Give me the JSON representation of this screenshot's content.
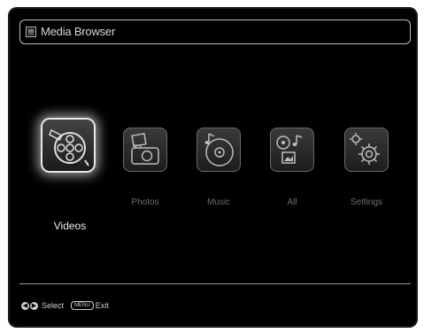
{
  "header": {
    "title": "Media Browser",
    "icon": "media-browser-icon"
  },
  "items": [
    {
      "label": "Videos",
      "icon": "film-reel-icon",
      "selected": true
    },
    {
      "label": "Photos",
      "icon": "photo-camera-icon",
      "selected": false
    },
    {
      "label": "Music",
      "icon": "music-disc-icon",
      "selected": false
    },
    {
      "label": "All",
      "icon": "all-media-icon",
      "selected": false
    },
    {
      "label": "Settings",
      "icon": "gear-icon",
      "selected": false
    }
  ],
  "footer": {
    "nav_left_glyph": "◀",
    "nav_right_glyph": "▶",
    "select_label": "Select",
    "menu_key": "MENU",
    "exit_label": "Exit"
  },
  "colors": {
    "background": "#000000",
    "text": "#d8d8d8",
    "inactive_label": "#6e6e6e"
  }
}
